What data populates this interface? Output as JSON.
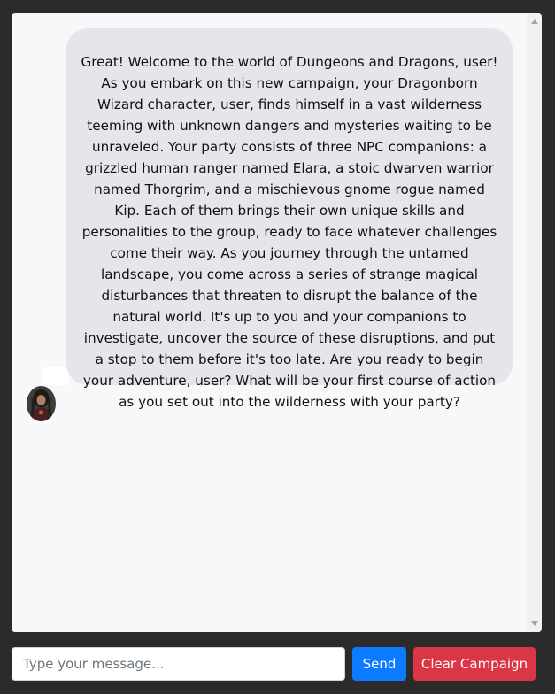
{
  "chat": {
    "messages": [
      {
        "sender": "assistant",
        "avatar_icon": "wizard-portrait-avatar",
        "text": "Great! Welcome to the world of Dungeons and Dragons, user! As you embark on this new campaign, your Dragonborn Wizard character, user, finds himself in a vast wilderness teeming with unknown dangers and mysteries waiting to be unraveled. Your party consists of three NPC companions: a grizzled human ranger named Elara, a stoic dwarven warrior named Thorgrim, and a mischievous gnome rogue named Kip. Each of them brings their own unique skills and personalities to the group, ready to face whatever challenges come their way. As you journey through the untamed landscape, you come across a series of strange magical disturbances that threaten to disrupt the balance of the natural world. It's up to you and your companions to investigate, uncover the source of these disruptions, and put a stop to them before it's too late. Are you ready to begin your adventure, user? What will be your first course of action as you set out into the wilderness with your party?"
      }
    ]
  },
  "composer": {
    "placeholder": "Type your message...",
    "value": ""
  },
  "buttons": {
    "send_label": "Send",
    "clear_label": "Clear Campaign"
  },
  "colors": {
    "background": "#2b2b2b",
    "panel": "#f7f8fa",
    "bubble": "#e6e5ea",
    "send": "#0d7bff",
    "clear": "#dc3545"
  }
}
